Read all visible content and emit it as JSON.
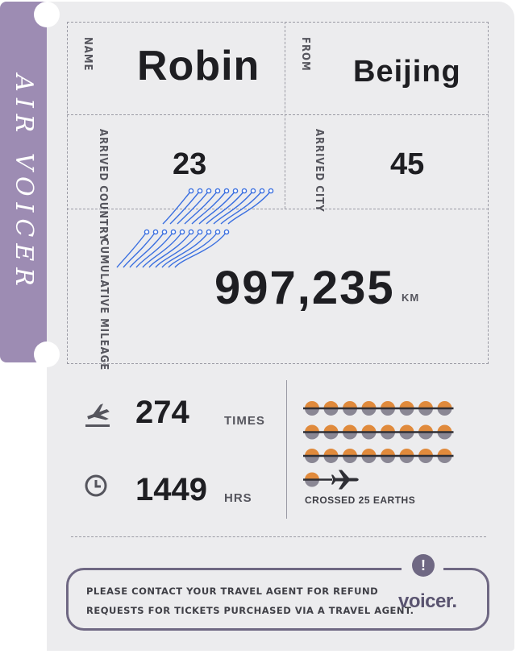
{
  "brand": {
    "stub_title": "AIR VOICER",
    "logo": "voicer.",
    "stub_color": "#9d8cb3",
    "accent": "#6f6883"
  },
  "passenger": {
    "name_label": "NAME",
    "name": "Robin",
    "from_label": "FROM",
    "from": "Beijing"
  },
  "stats": {
    "arrived_country_label": "ARRIVED COUNTRY",
    "arrived_country": "23",
    "arrived_city_label": "ARRIVED CITY",
    "arrived_city": "45",
    "mileage_label": "CUMULATIVE MILEAGE",
    "mileage": "997,235",
    "mileage_unit": "KM",
    "flights": "274",
    "flights_unit": "TIMES",
    "hours": "1449",
    "hours_unit": "HRS"
  },
  "earths": {
    "count": 25,
    "caption": "CROSSED 25 EARTHS",
    "colors": {
      "top": "#e08a3c",
      "bottom": "#8a8794"
    }
  },
  "notice": {
    "line1": "PLEASE CONTACT YOUR TRAVEL AGENT FOR REFUND",
    "line2": "REQUESTS FOR TICKETS PURCHASED VIA A TRAVEL AGENT.",
    "icon": "exclamation-icon"
  }
}
